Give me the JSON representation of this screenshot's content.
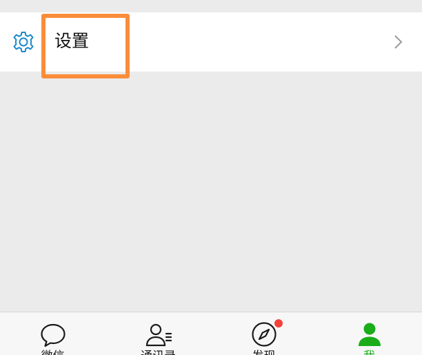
{
  "settings_row": {
    "label": "设置",
    "icon": "gear-icon",
    "chevron_icon": "chevron-right-icon"
  },
  "highlight": {
    "color": "#fa8c3a"
  },
  "tabbar": {
    "tabs": [
      {
        "label": "微信",
        "icon": "chat-bubble-icon",
        "active": false
      },
      {
        "label": "通讯录",
        "icon": "contacts-icon",
        "active": false
      },
      {
        "label": "发现",
        "icon": "compass-icon",
        "active": false,
        "badge": true
      },
      {
        "label": "我",
        "icon": "person-icon",
        "active": true
      }
    ],
    "active_color": "#1aad19",
    "badge_color": "#f5413b"
  }
}
